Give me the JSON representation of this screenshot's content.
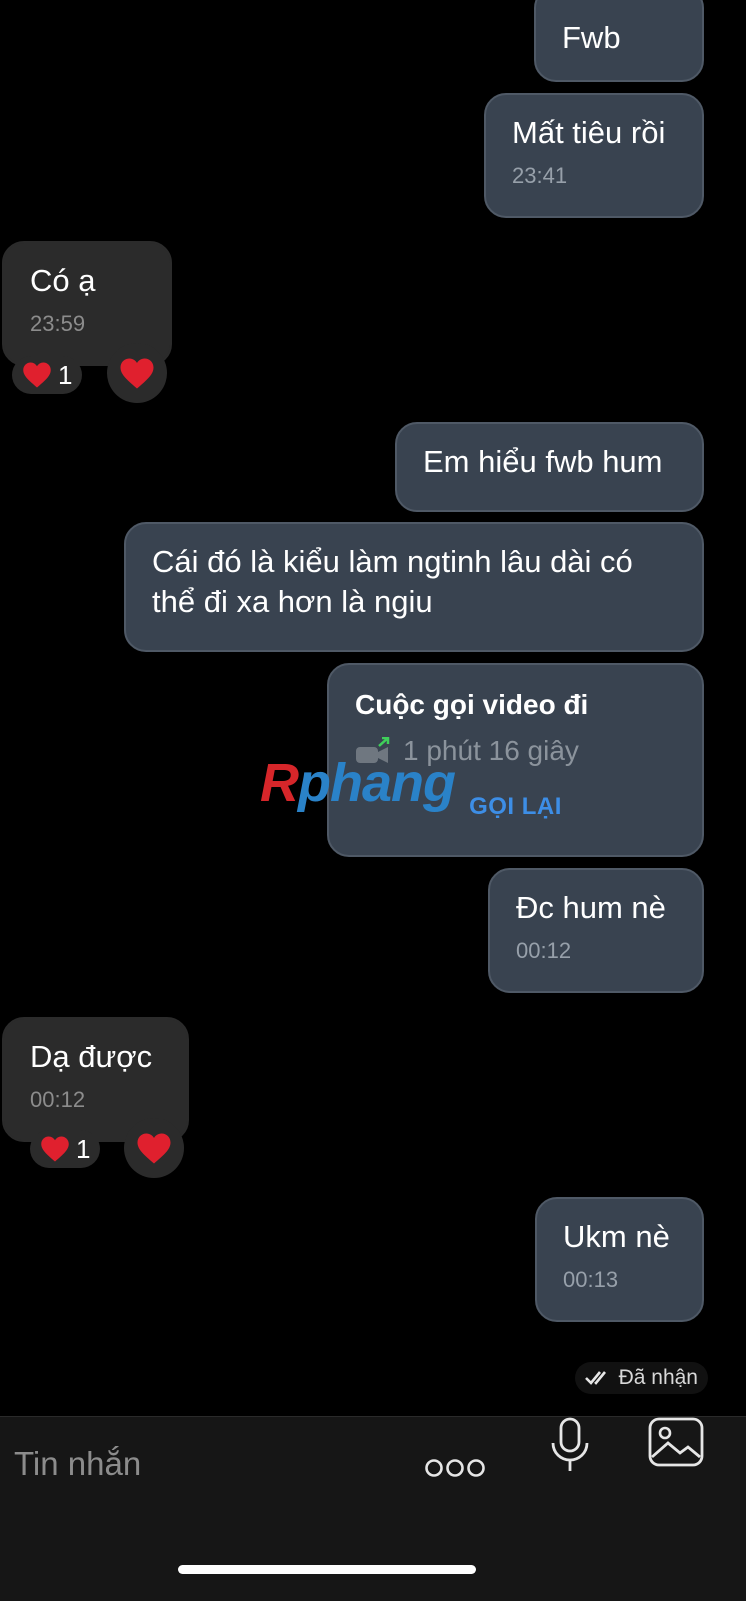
{
  "messages": [
    {
      "dir": "out",
      "text": "Fwb",
      "time": ""
    },
    {
      "dir": "out",
      "text": "Mất tiêu rồi",
      "time": "23:41"
    },
    {
      "dir": "in",
      "text": "Có ạ",
      "time": "23:59",
      "reaction": {
        "emoji": "heart",
        "count": "1"
      }
    },
    {
      "dir": "out",
      "text": "Em hiểu fwb hum",
      "time": ""
    },
    {
      "dir": "out",
      "text": "Cái đó là kiểu làm ngtinh lâu dài có thể đi xa hơn là ngiu",
      "time": ""
    },
    {
      "dir": "out",
      "text": "Đc hum nè",
      "time": "00:12"
    },
    {
      "dir": "in",
      "text": "Dạ được",
      "time": "00:12",
      "reaction": {
        "emoji": "heart",
        "count": "1"
      }
    },
    {
      "dir": "out",
      "text": "Ukm nè",
      "time": "00:13"
    }
  ],
  "call": {
    "title": "Cuộc gọi video đi",
    "duration": "1 phút 16 giây",
    "button": "GỌI LẠI",
    "icon": "video-camera-outgoing-icon"
  },
  "watermark": {
    "part1": "R",
    "part2": "phang"
  },
  "status": {
    "icon": "double-check-icon",
    "label": "Đã nhận"
  },
  "composer": {
    "placeholder": "Tin nhắn",
    "icons": [
      "more-dots-icon",
      "microphone-icon",
      "image-icon"
    ]
  },
  "colors": {
    "background": "#000000",
    "outgoing_bubble": "#394350",
    "incoming_bubble": "#2b2b2b",
    "accent": "#3d8ee6",
    "heart": "#e0202e"
  }
}
